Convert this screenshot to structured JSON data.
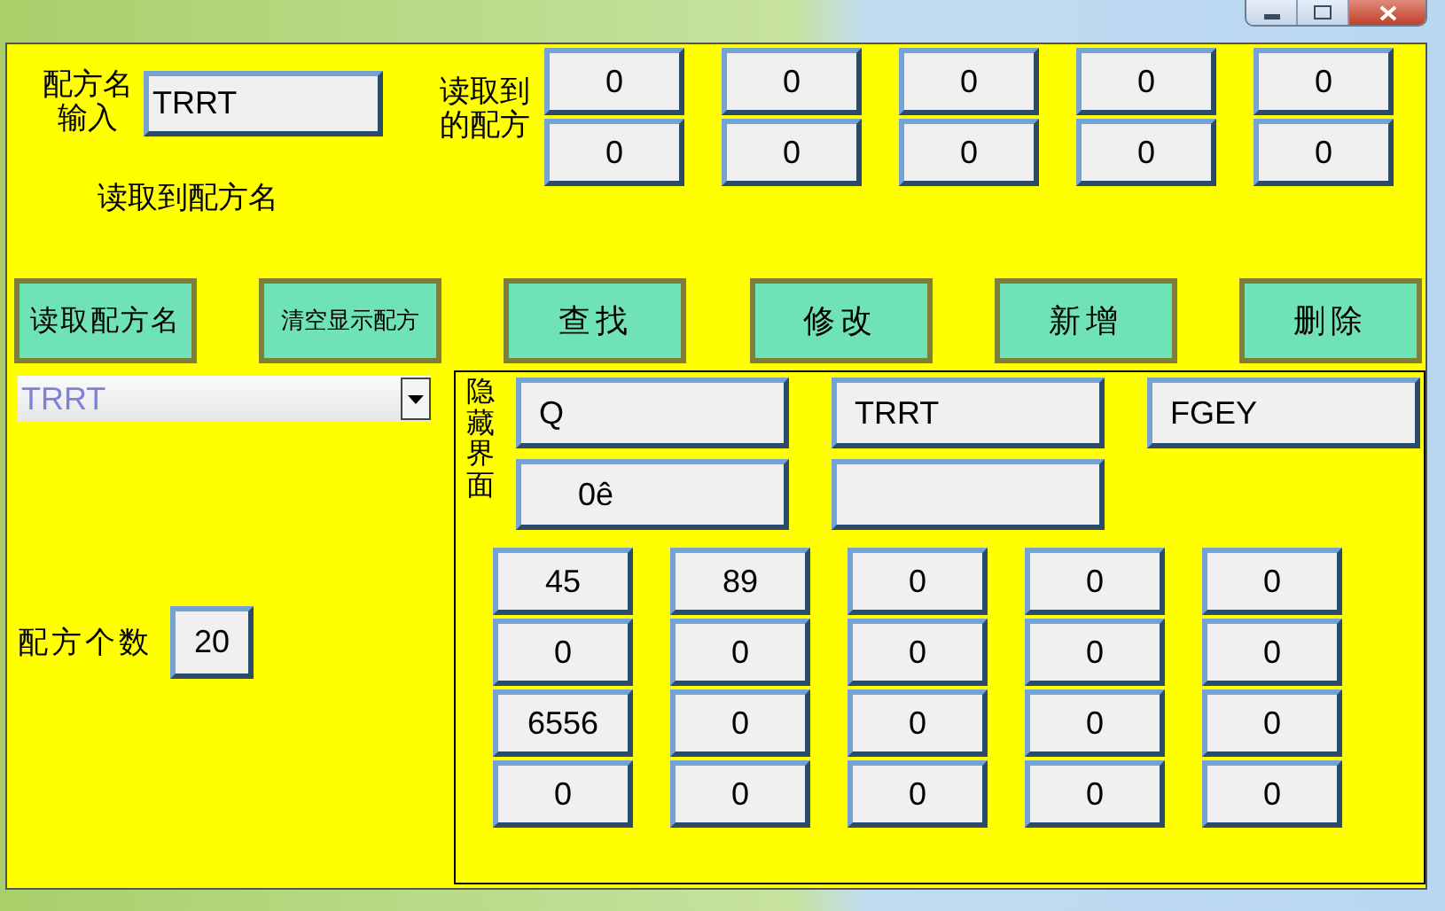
{
  "recipe_name_input": {
    "label_lines": [
      "配方名",
      "输入"
    ],
    "value": "TRRT"
  },
  "read_recipe": {
    "label_lines": [
      "读取到",
      "的配方"
    ],
    "values": [
      [
        "0",
        "0",
        "0",
        "0",
        "0"
      ],
      [
        "0",
        "0",
        "0",
        "0",
        "0"
      ]
    ]
  },
  "read_recipe_name_label": "读取到配方名",
  "buttons": [
    {
      "label": "读取配方名"
    },
    {
      "label": "清空显示配方"
    },
    {
      "label": "查找"
    },
    {
      "label": "修改"
    },
    {
      "label": "新增"
    },
    {
      "label": "删除"
    }
  ],
  "recipe_dropdown": {
    "value": "TRRT"
  },
  "recipe_count": {
    "label": "配方个数",
    "value": "20"
  },
  "hidden_panel": {
    "label": "隐藏界面",
    "fields": [
      {
        "value": "Q"
      },
      {
        "value": "TRRT"
      },
      {
        "value": "FGEY"
      },
      {
        "value": "0ê"
      }
    ],
    "values": [
      [
        "45",
        "89",
        "0",
        "0",
        "0"
      ],
      [
        "0",
        "0",
        "0",
        "0",
        "0"
      ],
      [
        "6556",
        "0",
        "0",
        "0",
        "0"
      ],
      [
        "0",
        "0",
        "0",
        "0",
        "0"
      ]
    ]
  }
}
